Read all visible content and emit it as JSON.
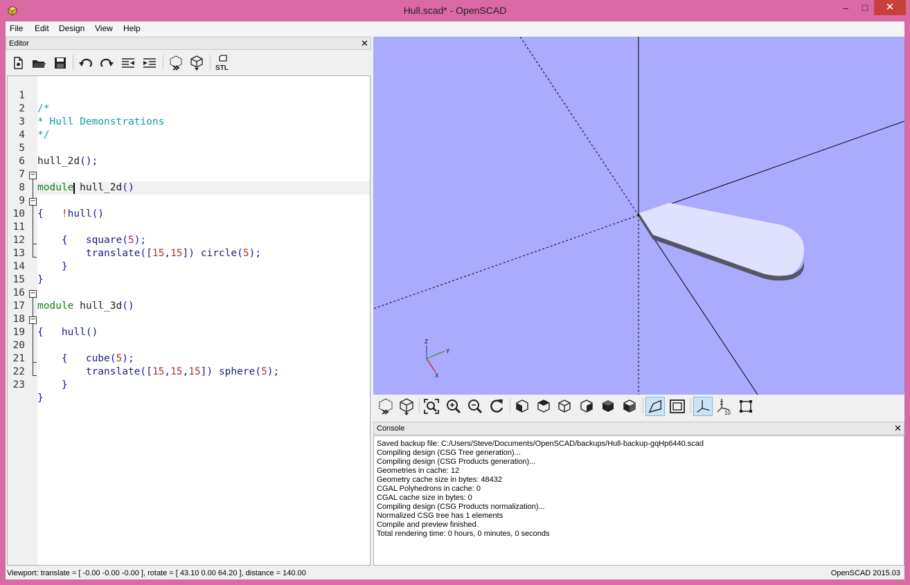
{
  "window": {
    "title": "Hull.scad* - OpenSCAD",
    "min_glyph": "–",
    "max_glyph": "□",
    "close_glyph": "✕"
  },
  "menubar": {
    "items": [
      "File",
      "Edit",
      "Design",
      "View",
      "Help"
    ]
  },
  "editor": {
    "title": "Editor",
    "close_glyph": "✕",
    "toolbar_icons": [
      "new-file-icon",
      "open-file-icon",
      "save-icon",
      "undo-icon",
      "redo-icon",
      "unindent-icon",
      "indent-icon",
      "preview-icon",
      "render-icon",
      "export-stl-icon"
    ],
    "stl_label": "STL",
    "line_numbers": [
      "1",
      "2",
      "3",
      "4",
      "5",
      "6",
      "7",
      "8",
      "9",
      "10",
      "11",
      "12",
      "13",
      "14",
      "15",
      "16",
      "17",
      "18",
      "19",
      "20",
      "21",
      "22",
      "23"
    ],
    "code": {
      "l1": "/*",
      "l2": "* Hull Demonstrations",
      "l3": "*/",
      "l5_a": "hull_2d",
      "l5_b": "();",
      "l7_kw": "module",
      "l7_name": " hull_2d",
      "l7_p": "()",
      "l8": "{",
      "l9_bang": "    !",
      "l9_name": "hull",
      "l9_p": "()",
      "l10": "    {",
      "l11_name": "        square",
      "l11_p1": "(",
      "l11_n": "5",
      "l11_p2": ");",
      "l12_name": "        translate",
      "l12_p1": "([",
      "l12_n1": "15",
      "l12_c": ",",
      "l12_n2": "15",
      "l12_p2": "])",
      "l12_name2": " circle",
      "l12_p3": "(",
      "l12_n3": "5",
      "l12_p4": ");",
      "l13": "    }",
      "l14": "}",
      "l16_kw": "module",
      "l16_name": " hull_3d",
      "l16_p": "()",
      "l17": "{",
      "l18_name": "    hull",
      "l18_p": "()",
      "l19": "    {",
      "l20_name": "        cube",
      "l20_p1": "(",
      "l20_n": "5",
      "l20_p2": ");",
      "l21_name": "        translate",
      "l21_p1": "([",
      "l21_n1": "15",
      "l21_c1": ",",
      "l21_n2": "15",
      "l21_c2": ",",
      "l21_n3": "15",
      "l21_p2": "])",
      "l21_name2": " sphere",
      "l21_p3": "(",
      "l21_n4": "5",
      "l21_p4": ");",
      "l22": "    }",
      "l23": "}"
    }
  },
  "viewport": {
    "background": "#aaaaff",
    "axes_labels": {
      "z": "Z",
      "y": "Y",
      "x": "X"
    }
  },
  "viewer_toolbar": {
    "icons": [
      "preview-icon",
      "render-icon",
      "view-all-icon",
      "zoom-in-icon",
      "zoom-out-icon",
      "reset-view-icon",
      "view-right-icon",
      "view-top-icon",
      "view-bottom-icon",
      "view-left-icon",
      "view-front-icon",
      "view-back-icon",
      "perspective-icon",
      "orthogonal-icon",
      "show-axes-icon",
      "show-scale-markers-icon",
      "show-edges-icon"
    ],
    "scale_marker_label": "10",
    "active": [
      "perspective-icon",
      "show-axes-icon"
    ]
  },
  "console": {
    "title": "Console",
    "close_glyph": "✕",
    "lines": [
      "Saved backup file: C:/Users/Steve/Documents/OpenSCAD/backups/Hull-backup-gqHp6440.scad",
      "Compiling design (CSG Tree generation)...",
      "Compiling design (CSG Products generation)...",
      "Geometries in cache: 12",
      "Geometry cache size in bytes: 48432",
      "CGAL Polyhedrons in cache: 0",
      "CGAL cache size in bytes: 0",
      "Compiling design (CSG Products normalization)...",
      "Normalized CSG tree has 1 elements",
      "Compile and preview finished.",
      "Total rendering time: 0 hours, 0 minutes, 0 seconds"
    ]
  },
  "statusbar": {
    "viewport": "Viewport: translate = [ -0.00 -0.00 -0.00 ], rotate = [ 43.10 0.00 64.20 ], distance = 140.00",
    "version": "OpenSCAD 2015.03"
  }
}
